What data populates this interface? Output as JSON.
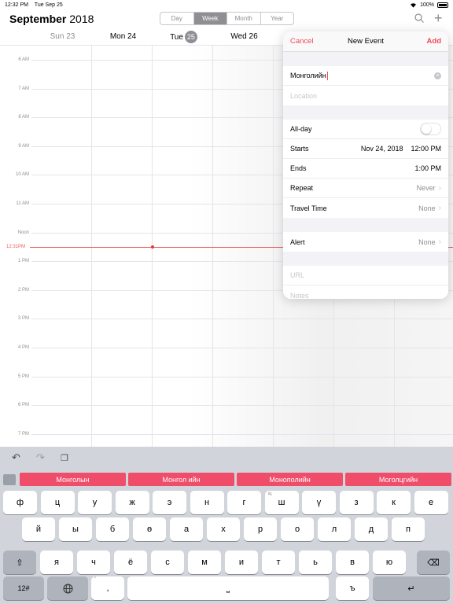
{
  "status": {
    "time": "12:32 PM",
    "date": "Tue Sep 25",
    "battery": "100%"
  },
  "header": {
    "month": "September",
    "year": "2018",
    "segments": [
      "Day",
      "Week",
      "Month",
      "Year"
    ],
    "active_segment": "Week"
  },
  "days": [
    {
      "label": "Sun 23",
      "muted": true
    },
    {
      "label": "Mon 24",
      "muted": false
    },
    {
      "label": "Tue",
      "badge": "25",
      "muted": false
    },
    {
      "label": "Wed 26",
      "muted": false
    }
  ],
  "hours": [
    "6 AM",
    "7 AM",
    "8 AM",
    "9 AM",
    "10 AM",
    "11 AM",
    "Noon",
    "1 PM",
    "2 PM",
    "3 PM",
    "4 PM",
    "5 PM",
    "6 PM",
    "7 PM"
  ],
  "now_label": "12:31PM",
  "event": {
    "cancel": "Cancel",
    "title": "New Event",
    "add": "Add",
    "title_value": "Монголийн",
    "location_placeholder": "Location",
    "allday_label": "All-day",
    "starts_label": "Starts",
    "starts_date": "Nov 24, 2018",
    "starts_time": "12:00 PM",
    "ends_label": "Ends",
    "ends_time": "1:00 PM",
    "repeat_label": "Repeat",
    "repeat_value": "Never",
    "travel_label": "Travel Time",
    "travel_value": "None",
    "alert_label": "Alert",
    "alert_value": "None",
    "url_placeholder": "URL",
    "notes_placeholder": "Notes"
  },
  "keyboard": {
    "suggestions": [
      "Монголын",
      "Монгол ийн",
      "Монополийн",
      "Моголцгийн"
    ],
    "row1": [
      "ф",
      "ц",
      "у",
      "ж",
      "э",
      "н",
      "г",
      "ш",
      "ү",
      "з",
      "к",
      "е"
    ],
    "row1_alt": [
      "",
      "",
      "",
      "",
      "",
      "",
      "",
      "щ",
      "",
      "",
      "",
      ""
    ],
    "row2": [
      "й",
      "ы",
      "б",
      "ө",
      "а",
      "х",
      "р",
      "о",
      "л",
      "д",
      "п"
    ],
    "row3": [
      "я",
      "ч",
      "ё",
      "с",
      "м",
      "и",
      "т",
      "ь",
      "в",
      "ю"
    ],
    "numbers_key": "12#",
    "comma": ",",
    "comma_alt": "\"",
    "hard_sign": "ъ"
  }
}
